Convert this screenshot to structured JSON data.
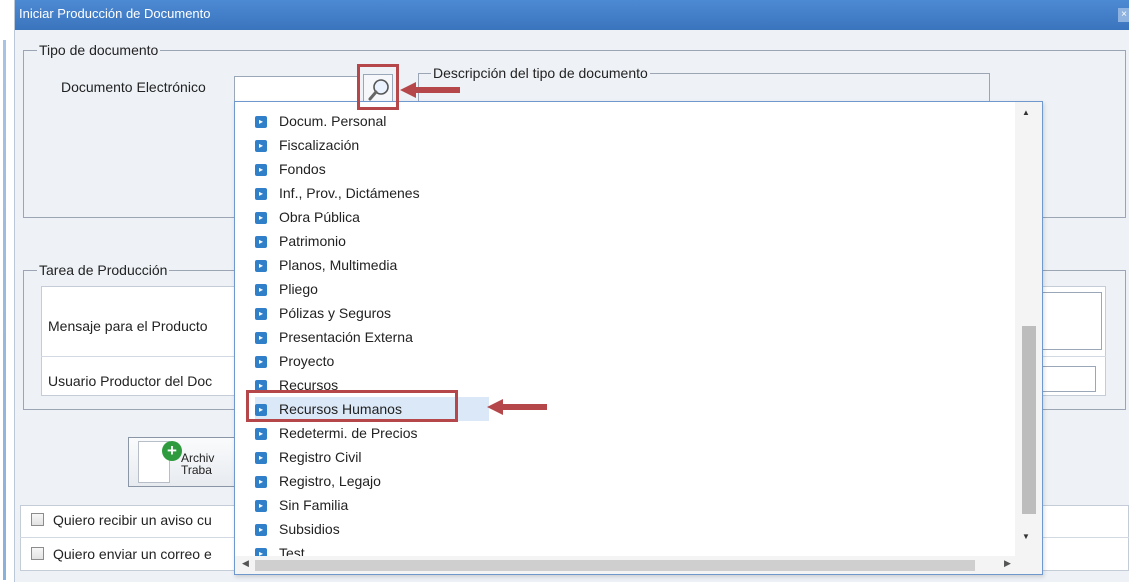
{
  "window": {
    "title": "Iniciar Producción de Documento",
    "close_glyph": "×"
  },
  "tipo_documento": {
    "legend": "Tipo de documento",
    "doc_label": "Documento Electrónico",
    "doc_value": "",
    "search_icon": "magnifier-icon",
    "descripcion_legend": "Descripción del tipo de documento"
  },
  "tarea": {
    "legend": "Tarea de Producción",
    "mensaje_label": "Mensaje para el Producto",
    "usuario_label": "Usuario Productor del Doc"
  },
  "archivos_button": {
    "line1": "Archiv",
    "line2": "Traba"
  },
  "checks": [
    {
      "label": "Quiero recibir un aviso cu",
      "checked": false
    },
    {
      "label": "Quiero enviar un correo e",
      "checked": false
    }
  ],
  "dropdown": {
    "items": [
      {
        "label": "Docum. Personal"
      },
      {
        "label": "Fiscalización"
      },
      {
        "label": "Fondos"
      },
      {
        "label": "Inf., Prov., Dictámenes"
      },
      {
        "label": "Obra Pública"
      },
      {
        "label": "Patrimonio"
      },
      {
        "label": "Planos, Multimedia"
      },
      {
        "label": "Pliego"
      },
      {
        "label": "Pólizas y Seguros"
      },
      {
        "label": "Presentación Externa"
      },
      {
        "label": "Proyecto"
      },
      {
        "label": "Recursos"
      },
      {
        "label": "Recursos Humanos",
        "selected": true
      },
      {
        "label": "Redetermi. de Precios"
      },
      {
        "label": "Registro Civil"
      },
      {
        "label": "Registro, Legajo"
      },
      {
        "label": "Sin Familia"
      },
      {
        "label": "Subsidios"
      },
      {
        "label": "Test"
      }
    ],
    "item_icon": "blue-arrow-icon",
    "selected_background": "#dbe8f7"
  },
  "annotation_color": "#b5474a"
}
